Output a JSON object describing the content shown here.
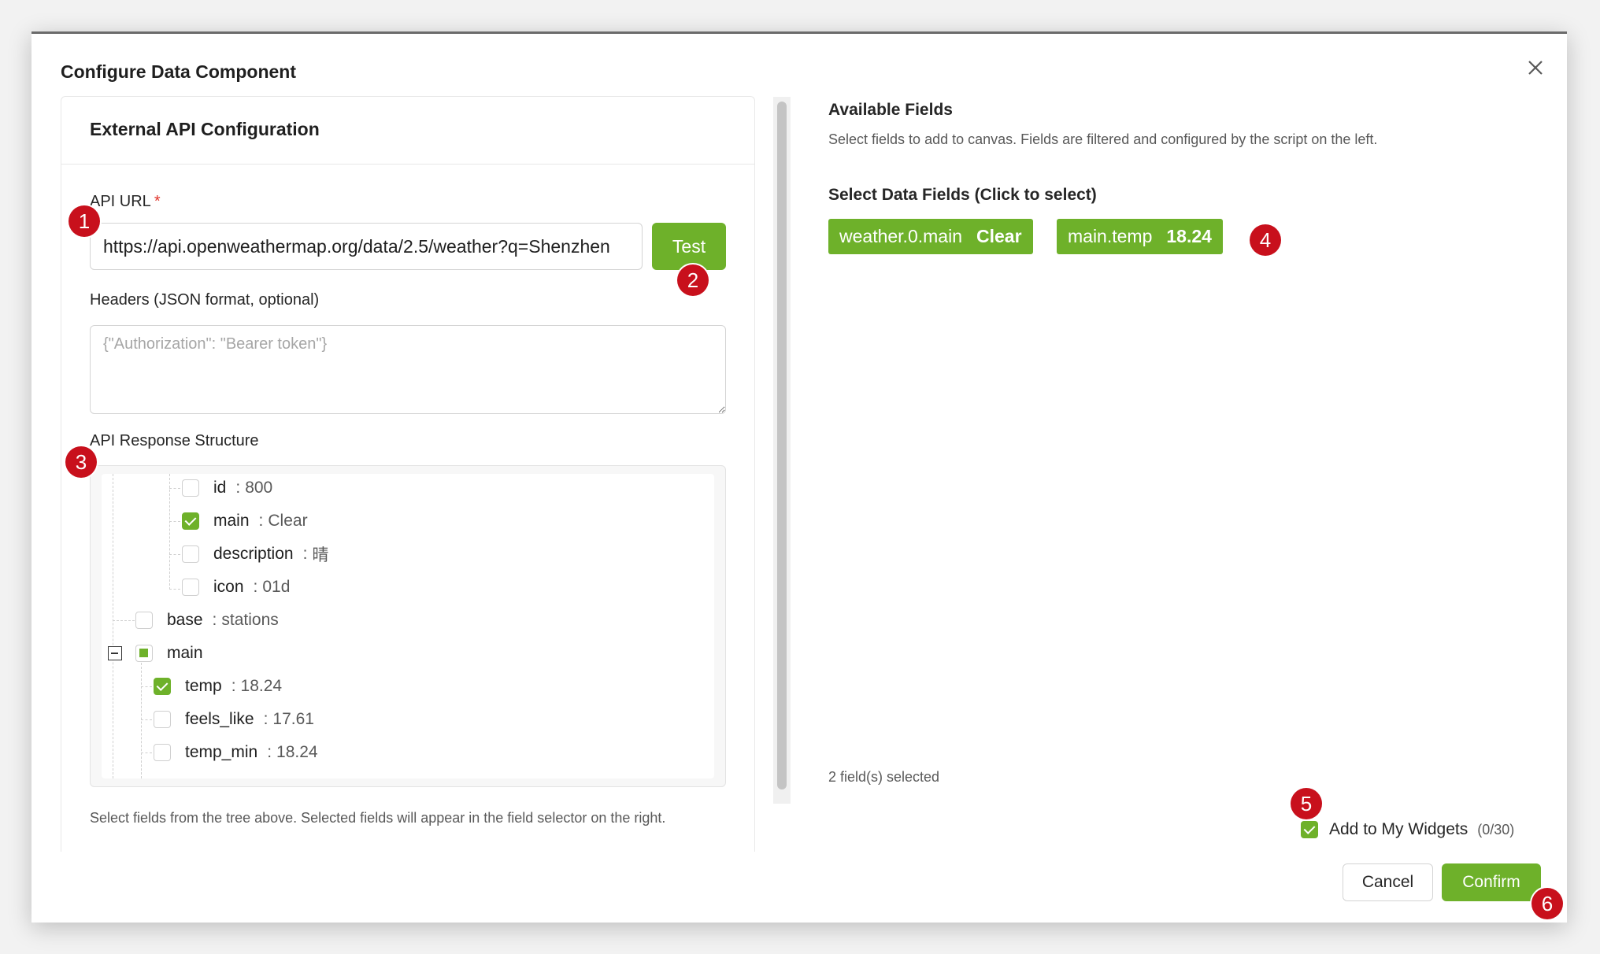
{
  "modal": {
    "title": "Configure Data Component"
  },
  "left": {
    "header_title": "External API Configuration",
    "api_url_label": "API URL",
    "required_mark": "*",
    "api_url_value": "https://api.openweathermap.org/data/2.5/weather?q=Shenzhen",
    "test_label": "Test",
    "headers_label": "Headers (JSON format, optional)",
    "headers_placeholder": "{\"Authorization\": \"Bearer token\"}",
    "structure_label": "API Response Structure",
    "help_text": "Select fields from the tree above. Selected fields will appear in the field selector on the right."
  },
  "tree": {
    "separator": ":",
    "rows": [
      {
        "key": "id",
        "value": "800",
        "checked": false
      },
      {
        "key": "main",
        "value": "Clear",
        "checked": true
      },
      {
        "key": "description",
        "value": "晴",
        "checked": false
      },
      {
        "key": "icon",
        "value": "01d",
        "checked": false
      },
      {
        "key": "base",
        "value": "stations",
        "checked": false
      },
      {
        "key": "main",
        "value": "",
        "checked": "partial",
        "expanded": true
      },
      {
        "key": "temp",
        "value": "18.24",
        "checked": true
      },
      {
        "key": "feels_like",
        "value": "17.61",
        "checked": false
      },
      {
        "key": "temp_min",
        "value": "18.24",
        "checked": false
      }
    ]
  },
  "right": {
    "available_title": "Available Fields",
    "available_desc": "Select fields to add to canvas. Fields are filtered and configured by the script on the left.",
    "select_title": "Select Data Fields (Click to select)",
    "chips": [
      {
        "field": "weather.0.main",
        "value": "Clear"
      },
      {
        "field": "main.temp",
        "value": "18.24"
      }
    ],
    "selected_count": "2 field(s) selected"
  },
  "footer": {
    "add_widgets_label": "Add to My Widgets",
    "add_widgets_checked": true,
    "widgets_count": "(0/30)",
    "cancel_label": "Cancel",
    "confirm_label": "Confirm"
  },
  "badges": [
    "1",
    "2",
    "3",
    "4",
    "5",
    "6"
  ],
  "colors": {
    "accent": "#6eb12a",
    "badge": "#c8101c",
    "required": "#e0342b"
  },
  "icons": {
    "close": "close-icon",
    "checkbox_checked": "checkmark-icon",
    "tree_expander": "collapse-minus-icon",
    "resize": "resize-handle-icon"
  }
}
